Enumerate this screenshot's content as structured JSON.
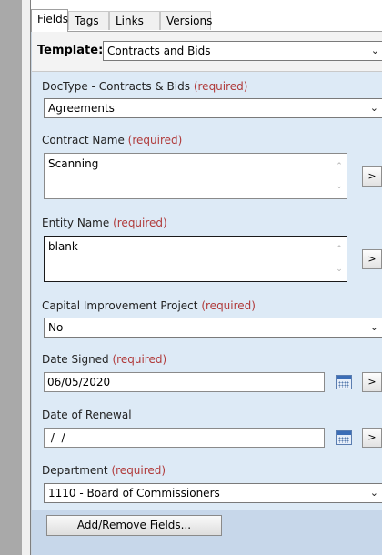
{
  "tabs": [
    {
      "label": "Fields"
    },
    {
      "label": "Tags"
    },
    {
      "label": "Links"
    },
    {
      "label": "Versions"
    }
  ],
  "template": {
    "label": "Template:",
    "value": "Contracts and Bids"
  },
  "required_text": "(required)",
  "fields": {
    "doctype": {
      "label": "DocType - Contracts & Bids",
      "value": "Agreements"
    },
    "contract_name": {
      "label": "Contract Name",
      "value": "Scanning"
    },
    "entity_name": {
      "label": "Entity Name",
      "value": "blank"
    },
    "capital_project": {
      "label": "Capital Improvement Project",
      "value": "No"
    },
    "date_signed": {
      "label": "Date Signed",
      "value": "06/05/2020"
    },
    "date_renewal": {
      "label": "Date of Renewal",
      "value": " /  /"
    },
    "department": {
      "label": "Department",
      "value": "1110 - Board of Commissioners"
    }
  },
  "buttons": {
    "side_arrow": ">",
    "add_remove": "Add/Remove Fields..."
  }
}
